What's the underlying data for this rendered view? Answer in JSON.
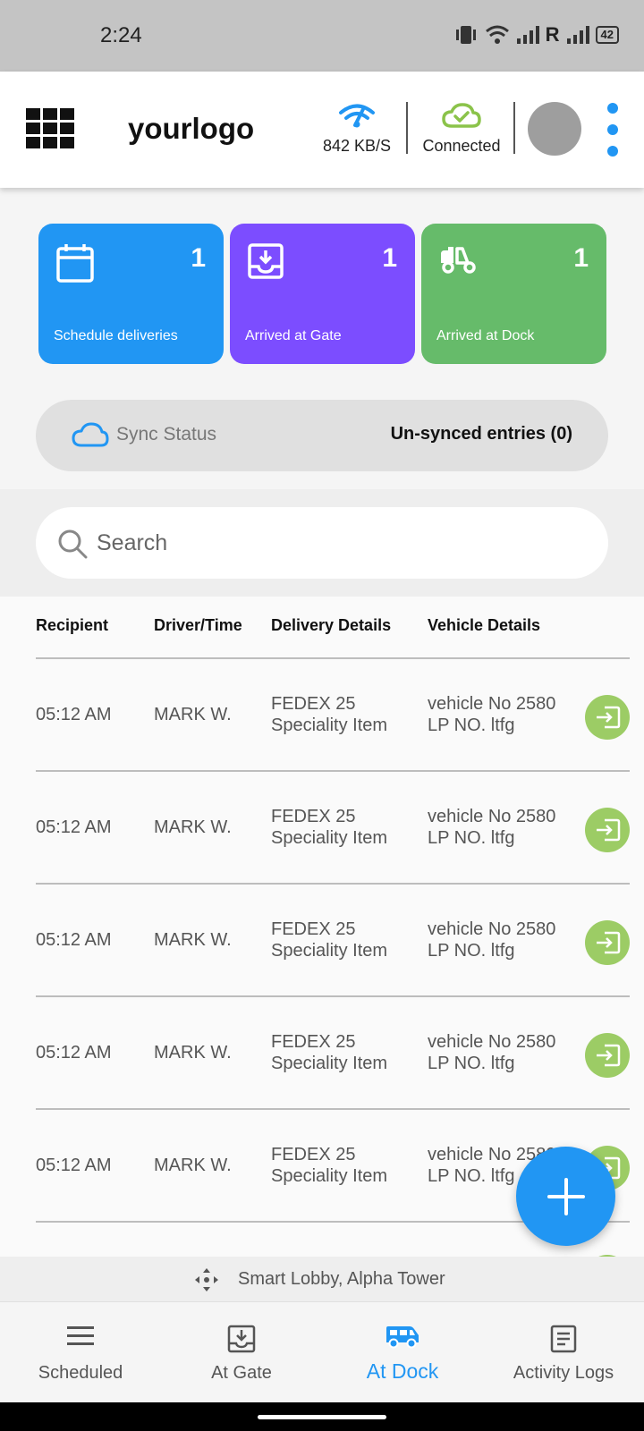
{
  "status_bar": {
    "time": "2:24",
    "battery": "42",
    "roaming": "R"
  },
  "header": {
    "logo": "yourlogo",
    "network_speed": "842 KB/S",
    "connection_status": "Connected"
  },
  "stats": [
    {
      "count": "1",
      "label": "Schedule deliveries",
      "color": "#2196f3",
      "icon": "calendar-icon"
    },
    {
      "count": "1",
      "label": "Arrived at Gate",
      "color": "#7c4dff",
      "icon": "inbox-download-icon"
    },
    {
      "count": "1",
      "label": "Arrived at Dock",
      "color": "#66bb6a",
      "icon": "truck-icon"
    }
  ],
  "sync": {
    "label": "Sync Status",
    "value": "Un-synced entries (0)"
  },
  "search": {
    "placeholder": "Search"
  },
  "table": {
    "headers": [
      "Recipient",
      "Driver/Time",
      "Delivery Details",
      "Vehicle Details"
    ],
    "rows": [
      {
        "time": "05:12 AM",
        "driver": "MARK W.",
        "delivery_1": "FEDEX 25",
        "delivery_2": "Speciality Item",
        "vehicle_1": "vehicle No 2580",
        "vehicle_2": "LP NO. ltfg"
      },
      {
        "time": "05:12 AM",
        "driver": "MARK W.",
        "delivery_1": "FEDEX 25",
        "delivery_2": "Speciality Item",
        "vehicle_1": "vehicle No 2580",
        "vehicle_2": "LP NO. ltfg"
      },
      {
        "time": "05:12 AM",
        "driver": "MARK W.",
        "delivery_1": "FEDEX 25",
        "delivery_2": "Speciality Item",
        "vehicle_1": "vehicle No 2580",
        "vehicle_2": "LP NO. ltfg"
      },
      {
        "time": "05:12 AM",
        "driver": "MARK W.",
        "delivery_1": "FEDEX 25",
        "delivery_2": "Speciality Item",
        "vehicle_1": "vehicle No 2580",
        "vehicle_2": "LP NO. ltfg"
      },
      {
        "time": "05:12 AM",
        "driver": "MARK W.",
        "delivery_1": "FEDEX 25",
        "delivery_2": "Speciality Item",
        "vehicle_1": "vehicle No 2580",
        "vehicle_2": "LP NO. ltfg"
      }
    ]
  },
  "location": "Smart Lobby, Alpha Tower",
  "nav": {
    "items": [
      {
        "label": "Scheduled",
        "icon": "menu-icon"
      },
      {
        "label": "At Gate",
        "icon": "inbox-download-icon"
      },
      {
        "label": "At Dock",
        "icon": "truck-icon",
        "active": true
      },
      {
        "label": "Activity Logs",
        "icon": "document-icon"
      }
    ]
  },
  "colors": {
    "accent": "#2196f3",
    "row_action": "#9ccc65"
  }
}
